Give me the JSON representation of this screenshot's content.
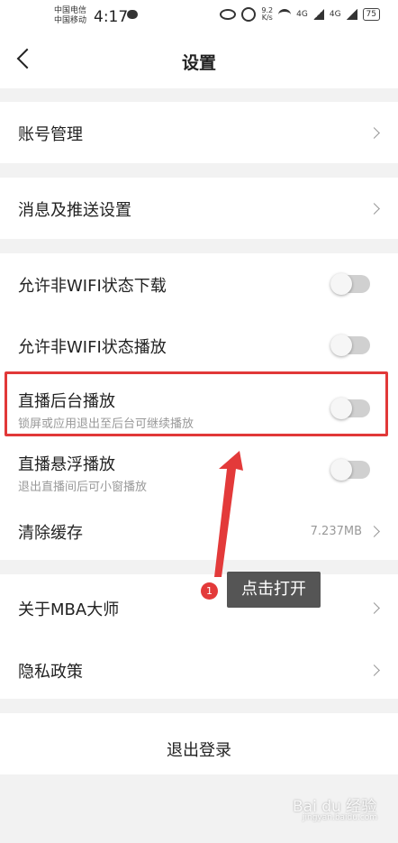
{
  "status_bar": {
    "carrier_1": "中国电信",
    "carrier_2": "中国移动",
    "time": "4:17",
    "speed": "9.2",
    "speed_unit": "K/s",
    "network_1": "4G",
    "network_2": "4G",
    "battery": "75"
  },
  "header": {
    "title": "设置"
  },
  "settings": {
    "account": {
      "label": "账号管理"
    },
    "notifications": {
      "label": "消息及推送设置"
    },
    "wifi_download": {
      "label": "允许非WIFI状态下载",
      "enabled": false
    },
    "wifi_play": {
      "label": "允许非WIFI状态播放",
      "enabled": false
    },
    "background_play": {
      "label": "直播后台播放",
      "description": "锁屏或应用退出至后台可继续播放",
      "enabled": false
    },
    "floating_play": {
      "label": "直播悬浮播放",
      "description": "退出直播间后可小窗播放",
      "enabled": false
    },
    "clear_cache": {
      "label": "清除缓存",
      "value": "7.237MB"
    },
    "about": {
      "label": "关于MBA大师"
    },
    "privacy": {
      "label": "隐私政策"
    },
    "logout": {
      "label": "退出登录"
    }
  },
  "annotation": {
    "step": "1",
    "text": "点击打开",
    "color": "#e13838"
  },
  "watermark": {
    "text": "Bai du 经验",
    "sub": "jingyan.baidu.com"
  }
}
